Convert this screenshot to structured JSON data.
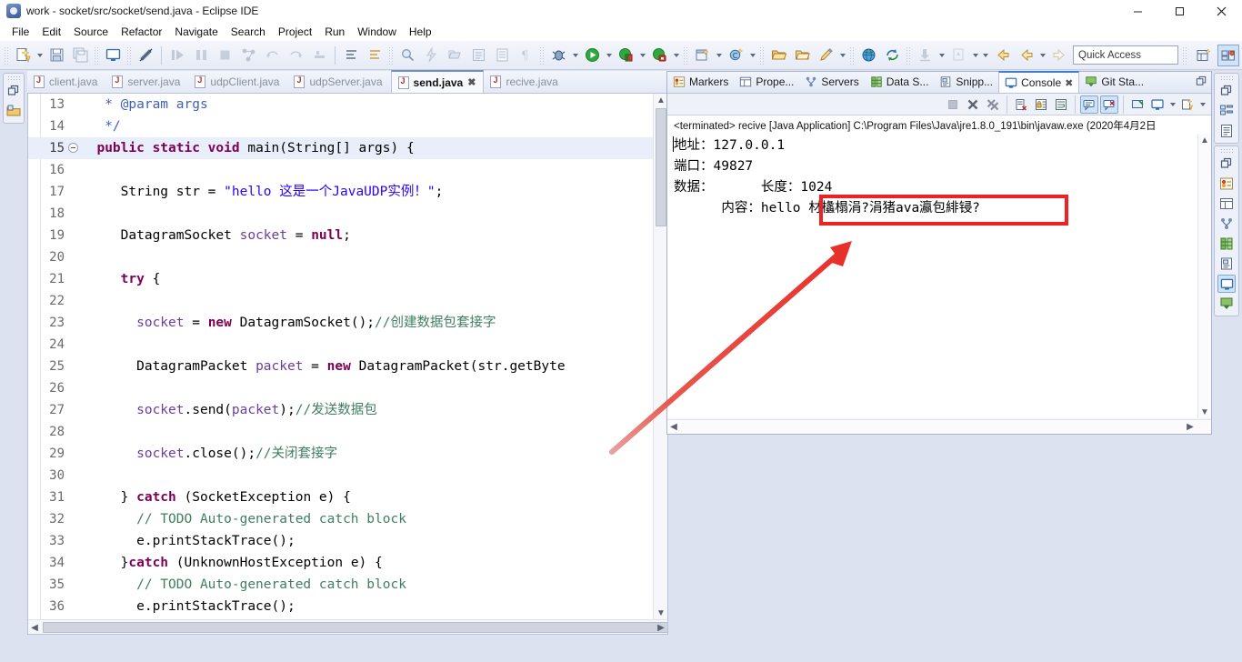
{
  "window": {
    "title": "work - socket/src/socket/send.java - Eclipse IDE",
    "icon": "eclipse-icon",
    "minimize": "–",
    "maximize": "□",
    "close": "✕"
  },
  "menubar": {
    "items": [
      "File",
      "Edit",
      "Source",
      "Refactor",
      "Navigate",
      "Search",
      "Project",
      "Run",
      "Window",
      "Help"
    ]
  },
  "toolbar": {
    "quick_access_placeholder": "Quick Access",
    "buttons": [
      "new-wizard-icon",
      "save-icon",
      "save-all-icon",
      "print-icon",
      "toggle-mark-occurrences-icon",
      "step-over-icon",
      "step-into-icon",
      "terminate-icon",
      "open-type-icon",
      "next-annotation-icon",
      "previous-annotation-icon",
      "last-edit-location-icon",
      "back-icon",
      "forward-icon",
      "search-icon",
      "debug-icon",
      "run-icon",
      "coverage-icon",
      "profile-icon",
      "new-java-project-icon",
      "new-class-icon",
      "open-folder-icon",
      "pencil-icon",
      "globe-icon",
      "sync-icon",
      "pull-icon",
      "push-icon"
    ],
    "perspective_buttons": [
      "open-perspective-icon",
      "java-perspective-icon"
    ]
  },
  "editor": {
    "tabs": [
      {
        "label": "client.java",
        "active": false,
        "closable": false
      },
      {
        "label": "server.java",
        "active": false,
        "closable": false
      },
      {
        "label": "udpClient.java",
        "active": false,
        "closable": false
      },
      {
        "label": "udpServer.java",
        "active": false,
        "closable": false
      },
      {
        "label": "send.java",
        "active": true,
        "closable": true
      },
      {
        "label": "recive.java",
        "active": false,
        "closable": false
      }
    ],
    "close_glyph": "✖",
    "lines": [
      {
        "n": "13",
        "fold": false,
        "hl": false,
        "parts": [
          {
            "t": "   * @param args",
            "c": "jd"
          }
        ]
      },
      {
        "n": "14",
        "fold": false,
        "hl": false,
        "parts": [
          {
            "t": "   */",
            "c": "jd"
          }
        ]
      },
      {
        "n": "15",
        "fold": true,
        "hl": true,
        "parts": [
          {
            "t": "  ",
            "c": "pl"
          },
          {
            "t": "public static void ",
            "c": "kw"
          },
          {
            "t": "main(String[] args) {",
            "c": "pl"
          }
        ]
      },
      {
        "n": "16",
        "fold": false,
        "hl": false,
        "parts": [
          {
            "t": "",
            "c": "pl"
          }
        ]
      },
      {
        "n": "17",
        "fold": false,
        "hl": false,
        "parts": [
          {
            "t": "     String str = ",
            "c": "pl"
          },
          {
            "t": "\"hello 这是一个JavaUDP实例！\"",
            "c": "st"
          },
          {
            "t": ";",
            "c": "pl"
          }
        ]
      },
      {
        "n": "18",
        "fold": false,
        "hl": false,
        "parts": [
          {
            "t": "",
            "c": "pl"
          }
        ]
      },
      {
        "n": "19",
        "fold": false,
        "hl": false,
        "parts": [
          {
            "t": "     DatagramSocket ",
            "c": "pl"
          },
          {
            "t": "socket",
            "c": "fld"
          },
          {
            "t": " = ",
            "c": "pl"
          },
          {
            "t": "null",
            "c": "kw"
          },
          {
            "t": ";",
            "c": "pl"
          }
        ]
      },
      {
        "n": "20",
        "fold": false,
        "hl": false,
        "parts": [
          {
            "t": "",
            "c": "pl"
          }
        ]
      },
      {
        "n": "21",
        "fold": false,
        "hl": false,
        "parts": [
          {
            "t": "     ",
            "c": "pl"
          },
          {
            "t": "try",
            "c": "kw"
          },
          {
            "t": " {",
            "c": "pl"
          }
        ]
      },
      {
        "n": "22",
        "fold": false,
        "hl": false,
        "parts": [
          {
            "t": "",
            "c": "pl"
          }
        ]
      },
      {
        "n": "23",
        "fold": false,
        "hl": false,
        "parts": [
          {
            "t": "       ",
            "c": "pl"
          },
          {
            "t": "socket",
            "c": "fld"
          },
          {
            "t": " = ",
            "c": "pl"
          },
          {
            "t": "new",
            "c": "kw"
          },
          {
            "t": " DatagramSocket();",
            "c": "pl"
          },
          {
            "t": "//创建数据包套接字",
            "c": "cm"
          }
        ]
      },
      {
        "n": "24",
        "fold": false,
        "hl": false,
        "parts": [
          {
            "t": "",
            "c": "pl"
          }
        ]
      },
      {
        "n": "25",
        "fold": false,
        "hl": false,
        "parts": [
          {
            "t": "       DatagramPacket ",
            "c": "pl"
          },
          {
            "t": "packet",
            "c": "fld"
          },
          {
            "t": " = ",
            "c": "pl"
          },
          {
            "t": "new",
            "c": "kw"
          },
          {
            "t": " DatagramPacket(str.getByte",
            "c": "pl"
          }
        ]
      },
      {
        "n": "26",
        "fold": false,
        "hl": false,
        "parts": [
          {
            "t": "",
            "c": "pl"
          }
        ]
      },
      {
        "n": "27",
        "fold": false,
        "hl": false,
        "parts": [
          {
            "t": "       ",
            "c": "pl"
          },
          {
            "t": "socket",
            "c": "fld"
          },
          {
            "t": ".send(",
            "c": "pl"
          },
          {
            "t": "packet",
            "c": "fld"
          },
          {
            "t": ");",
            "c": "pl"
          },
          {
            "t": "//发送数据包",
            "c": "cm"
          }
        ]
      },
      {
        "n": "28",
        "fold": false,
        "hl": false,
        "parts": [
          {
            "t": "",
            "c": "pl"
          }
        ]
      },
      {
        "n": "29",
        "fold": false,
        "hl": false,
        "parts": [
          {
            "t": "       ",
            "c": "pl"
          },
          {
            "t": "socket",
            "c": "fld"
          },
          {
            "t": ".close();",
            "c": "pl"
          },
          {
            "t": "//关闭套接字",
            "c": "cm"
          }
        ]
      },
      {
        "n": "30",
        "fold": false,
        "hl": false,
        "parts": [
          {
            "t": "",
            "c": "pl"
          }
        ]
      },
      {
        "n": "31",
        "fold": false,
        "hl": false,
        "parts": [
          {
            "t": "     } ",
            "c": "pl"
          },
          {
            "t": "catch",
            "c": "kw"
          },
          {
            "t": " (SocketException e) {",
            "c": "pl"
          }
        ]
      },
      {
        "n": "32",
        "fold": false,
        "hl": false,
        "parts": [
          {
            "t": "       // TODO Auto-generated catch block",
            "c": "cm"
          }
        ]
      },
      {
        "n": "33",
        "fold": false,
        "hl": false,
        "parts": [
          {
            "t": "       e.printStackTrace();",
            "c": "pl"
          }
        ]
      },
      {
        "n": "34",
        "fold": false,
        "hl": false,
        "parts": [
          {
            "t": "     }",
            "c": "pl"
          },
          {
            "t": "catch",
            "c": "kw"
          },
          {
            "t": " (UnknownHostException e) {",
            "c": "pl"
          }
        ]
      },
      {
        "n": "35",
        "fold": false,
        "hl": false,
        "parts": [
          {
            "t": "       // TODO Auto-generated catch block",
            "c": "cm"
          }
        ]
      },
      {
        "n": "36",
        "fold": false,
        "hl": false,
        "parts": [
          {
            "t": "       e.printStackTrace();",
            "c": "pl"
          }
        ]
      }
    ]
  },
  "console": {
    "tabs": [
      {
        "label": "Markers",
        "icon": "markers-icon",
        "active": false
      },
      {
        "label": "Prope...",
        "icon": "properties-icon",
        "active": false
      },
      {
        "label": "Servers",
        "icon": "servers-icon",
        "active": false
      },
      {
        "label": "Data S...",
        "icon": "data-source-icon",
        "active": false
      },
      {
        "label": "Snipp...",
        "icon": "snippets-icon",
        "active": false
      },
      {
        "label": "Console",
        "icon": "console-icon",
        "active": true
      },
      {
        "label": "Git Sta...",
        "icon": "git-staging-icon",
        "active": false
      }
    ],
    "close_glyph": "✖",
    "minimize_glyph": "⌧",
    "toolbar_buttons": [
      "terminate-icon",
      "remove-launch-icon",
      "remove-all-terminated-icon",
      "clear-console-icon",
      "scroll-lock-icon",
      "word-wrap-icon",
      "show-console-on-output-icon",
      "show-console-on-error-icon",
      "pin-console-icon",
      "display-selected-console-icon",
      "open-console-icon"
    ],
    "launch_header": "<terminated> recive [Java Application] C:\\Program Files\\Java\\jre1.8.0_191\\bin\\javaw.exe (2020年4月2日",
    "output_lines": [
      "地址：127.0.0.1",
      "端口：49827",
      "数据：      长度：1024",
      "      内容：hello 材欚榻涓?涓猪ava瀛包緋锓?"
    ],
    "output_prefix_line4": "      内容：hello ",
    "highlighted_garbled": "材欚榻涓?涓猪ava瀛包緋锓?"
  },
  "annotations": {
    "highlight_color": "#ee2222",
    "arrow_color": "#e23b3b",
    "box_label": "garbled-output-highlight",
    "arrow_label": "pointer-arrow"
  },
  "rails": {
    "left": [
      "restore-icon",
      "package-explorer-icon"
    ],
    "right_top": [
      "restore-icon",
      "outline-icon",
      "task-list-icon"
    ],
    "right_bottom": [
      "restore-icon",
      "markers-icon",
      "properties-icon",
      "servers-icon",
      "data-source-icon",
      "snippets-icon",
      "console-icon",
      "git-staging-icon"
    ]
  }
}
